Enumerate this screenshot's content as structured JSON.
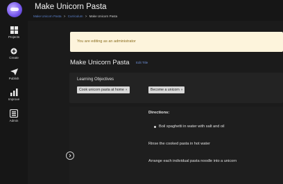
{
  "app": {
    "title": "Make Unicorn Pasta"
  },
  "sidebar": {
    "items": [
      {
        "label": "Projects",
        "icon": "grid-icon"
      },
      {
        "label": "Create",
        "icon": "plus-icon"
      },
      {
        "label": "Publish",
        "icon": "send-icon"
      },
      {
        "label": "Improve",
        "icon": "chart-icon"
      },
      {
        "label": "Admin",
        "icon": "admin-icon"
      }
    ]
  },
  "breadcrumb": {
    "items": [
      "Make Unicorn Pasta",
      "Curriculum",
      "Make Unicorn Pasta"
    ],
    "separator": ">"
  },
  "banner": {
    "text": "You are editing as an administrator"
  },
  "page": {
    "title": "Make Unicorn Pasta",
    "edit_label": "Edit Title"
  },
  "objectives": {
    "label": "Learning Objectives",
    "chips": [
      {
        "label": "Cook unicorn pasta at home",
        "remove": "×"
      },
      {
        "label": "Become a unicorn",
        "remove": "×"
      }
    ]
  },
  "directions": {
    "heading": "Directions:",
    "steps": [
      "Boil spaghetti in water with salt and oil",
      "Rinse the cooked pasta in hot water",
      "Arrange each individual pasta noodle into a unicorn"
    ]
  },
  "colors": {
    "background": "#161616",
    "banner": "#fdf4dc",
    "banner_text": "#8a6d1e",
    "link": "#5b80c9",
    "chip": "#d9d9d9"
  }
}
